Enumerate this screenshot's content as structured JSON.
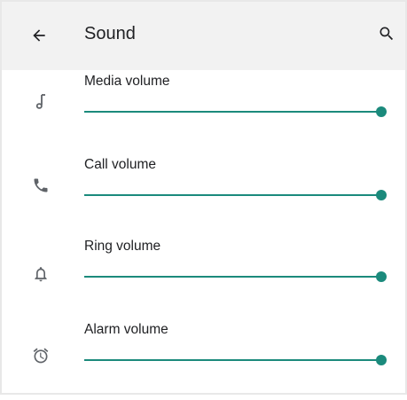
{
  "appbar": {
    "title": "Sound",
    "back_icon": "arrow-left-icon",
    "search_icon": "search-icon"
  },
  "volumes": [
    {
      "label": "Media volume",
      "icon": "music-note-icon",
      "level": 1.0
    },
    {
      "label": "Call volume",
      "icon": "phone-icon",
      "level": 1.0
    },
    {
      "label": "Ring volume",
      "icon": "bell-icon",
      "level": 1.0
    },
    {
      "label": "Alarm volume",
      "icon": "alarm-clock-icon",
      "level": 1.0
    }
  ],
  "colors": {
    "accent": "#1b8a7c",
    "appbar_bg": "#f2f2f2",
    "text": "#202124",
    "icon": "#5f6368"
  }
}
